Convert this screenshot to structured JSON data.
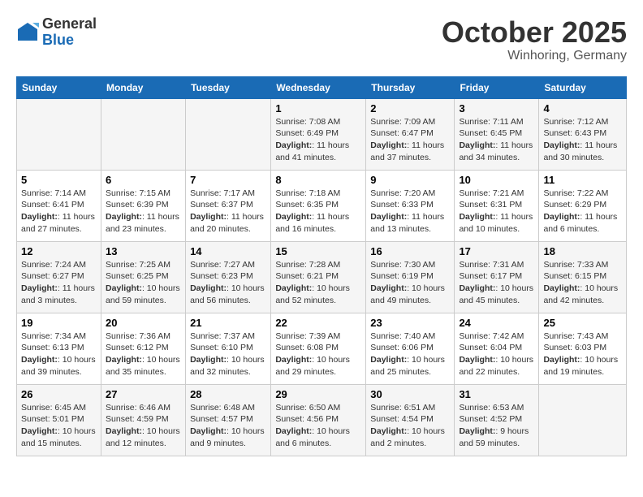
{
  "header": {
    "logo_general": "General",
    "logo_blue": "Blue",
    "month_title": "October 2025",
    "location": "Winhoring, Germany"
  },
  "weekdays": [
    "Sunday",
    "Monday",
    "Tuesday",
    "Wednesday",
    "Thursday",
    "Friday",
    "Saturday"
  ],
  "weeks": [
    [
      {
        "day": "",
        "content": ""
      },
      {
        "day": "",
        "content": ""
      },
      {
        "day": "",
        "content": ""
      },
      {
        "day": "1",
        "content": "Sunrise: 7:08 AM\nSunset: 6:49 PM\nDaylight: 11 hours and 41 minutes."
      },
      {
        "day": "2",
        "content": "Sunrise: 7:09 AM\nSunset: 6:47 PM\nDaylight: 11 hours and 37 minutes."
      },
      {
        "day": "3",
        "content": "Sunrise: 7:11 AM\nSunset: 6:45 PM\nDaylight: 11 hours and 34 minutes."
      },
      {
        "day": "4",
        "content": "Sunrise: 7:12 AM\nSunset: 6:43 PM\nDaylight: 11 hours and 30 minutes."
      }
    ],
    [
      {
        "day": "5",
        "content": "Sunrise: 7:14 AM\nSunset: 6:41 PM\nDaylight: 11 hours and 27 minutes."
      },
      {
        "day": "6",
        "content": "Sunrise: 7:15 AM\nSunset: 6:39 PM\nDaylight: 11 hours and 23 minutes."
      },
      {
        "day": "7",
        "content": "Sunrise: 7:17 AM\nSunset: 6:37 PM\nDaylight: 11 hours and 20 minutes."
      },
      {
        "day": "8",
        "content": "Sunrise: 7:18 AM\nSunset: 6:35 PM\nDaylight: 11 hours and 16 minutes."
      },
      {
        "day": "9",
        "content": "Sunrise: 7:20 AM\nSunset: 6:33 PM\nDaylight: 11 hours and 13 minutes."
      },
      {
        "day": "10",
        "content": "Sunrise: 7:21 AM\nSunset: 6:31 PM\nDaylight: 11 hours and 10 minutes."
      },
      {
        "day": "11",
        "content": "Sunrise: 7:22 AM\nSunset: 6:29 PM\nDaylight: 11 hours and 6 minutes."
      }
    ],
    [
      {
        "day": "12",
        "content": "Sunrise: 7:24 AM\nSunset: 6:27 PM\nDaylight: 11 hours and 3 minutes."
      },
      {
        "day": "13",
        "content": "Sunrise: 7:25 AM\nSunset: 6:25 PM\nDaylight: 10 hours and 59 minutes."
      },
      {
        "day": "14",
        "content": "Sunrise: 7:27 AM\nSunset: 6:23 PM\nDaylight: 10 hours and 56 minutes."
      },
      {
        "day": "15",
        "content": "Sunrise: 7:28 AM\nSunset: 6:21 PM\nDaylight: 10 hours and 52 minutes."
      },
      {
        "day": "16",
        "content": "Sunrise: 7:30 AM\nSunset: 6:19 PM\nDaylight: 10 hours and 49 minutes."
      },
      {
        "day": "17",
        "content": "Sunrise: 7:31 AM\nSunset: 6:17 PM\nDaylight: 10 hours and 45 minutes."
      },
      {
        "day": "18",
        "content": "Sunrise: 7:33 AM\nSunset: 6:15 PM\nDaylight: 10 hours and 42 minutes."
      }
    ],
    [
      {
        "day": "19",
        "content": "Sunrise: 7:34 AM\nSunset: 6:13 PM\nDaylight: 10 hours and 39 minutes."
      },
      {
        "day": "20",
        "content": "Sunrise: 7:36 AM\nSunset: 6:12 PM\nDaylight: 10 hours and 35 minutes."
      },
      {
        "day": "21",
        "content": "Sunrise: 7:37 AM\nSunset: 6:10 PM\nDaylight: 10 hours and 32 minutes."
      },
      {
        "day": "22",
        "content": "Sunrise: 7:39 AM\nSunset: 6:08 PM\nDaylight: 10 hours and 29 minutes."
      },
      {
        "day": "23",
        "content": "Sunrise: 7:40 AM\nSunset: 6:06 PM\nDaylight: 10 hours and 25 minutes."
      },
      {
        "day": "24",
        "content": "Sunrise: 7:42 AM\nSunset: 6:04 PM\nDaylight: 10 hours and 22 minutes."
      },
      {
        "day": "25",
        "content": "Sunrise: 7:43 AM\nSunset: 6:03 PM\nDaylight: 10 hours and 19 minutes."
      }
    ],
    [
      {
        "day": "26",
        "content": "Sunrise: 6:45 AM\nSunset: 5:01 PM\nDaylight: 10 hours and 15 minutes."
      },
      {
        "day": "27",
        "content": "Sunrise: 6:46 AM\nSunset: 4:59 PM\nDaylight: 10 hours and 12 minutes."
      },
      {
        "day": "28",
        "content": "Sunrise: 6:48 AM\nSunset: 4:57 PM\nDaylight: 10 hours and 9 minutes."
      },
      {
        "day": "29",
        "content": "Sunrise: 6:50 AM\nSunset: 4:56 PM\nDaylight: 10 hours and 6 minutes."
      },
      {
        "day": "30",
        "content": "Sunrise: 6:51 AM\nSunset: 4:54 PM\nDaylight: 10 hours and 2 minutes."
      },
      {
        "day": "31",
        "content": "Sunrise: 6:53 AM\nSunset: 4:52 PM\nDaylight: 9 hours and 59 minutes."
      },
      {
        "day": "",
        "content": ""
      }
    ]
  ]
}
